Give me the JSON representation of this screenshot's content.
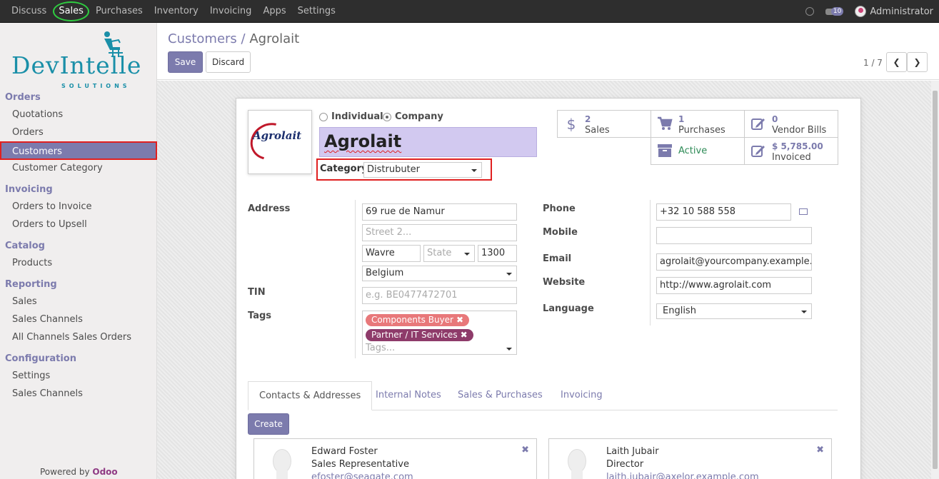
{
  "topbar": {
    "menu": [
      "Discuss",
      "Sales",
      "Purchases",
      "Inventory",
      "Invoicing",
      "Apps",
      "Settings"
    ],
    "active_menu": "Sales",
    "chat_count": "10",
    "user": "Administrator"
  },
  "sidebar": {
    "logo_word": "DevIntelle",
    "logo_sub": "SOLUTIONS",
    "sections": [
      {
        "title": "Orders",
        "items": [
          "Quotations",
          "Orders",
          "Customers",
          "Customer Category"
        ]
      },
      {
        "title": "Invoicing",
        "items": [
          "Orders to Invoice",
          "Orders to Upsell"
        ]
      },
      {
        "title": "Catalog",
        "items": [
          "Products"
        ]
      },
      {
        "title": "Reporting",
        "items": [
          "Sales",
          "Sales Channels",
          "All Channels Sales Orders"
        ]
      },
      {
        "title": "Configuration",
        "items": [
          "Settings",
          "Sales Channels"
        ]
      }
    ],
    "active_item": "Customers",
    "powered_by": "Powered by",
    "powered_brand": "Odoo"
  },
  "control_panel": {
    "breadcrumb_parent": "Customers",
    "breadcrumb_sep": "/",
    "breadcrumb_current": "Agrolait",
    "save_label": "Save",
    "discard_label": "Discard",
    "pager": "1 / 7",
    "prev_icon": "chevron-left-icon",
    "next_icon": "chevron-right-icon"
  },
  "partner": {
    "logo_text": "Agrolait",
    "type_individual": "Individual",
    "type_company": "Company",
    "selected_type": "Company",
    "name": "Agrolait",
    "category_label": "Category",
    "category_value": "Distrubuter"
  },
  "smart_buttons": {
    "sales_count": "2",
    "sales_label": "Sales",
    "purchases_count": "1",
    "purchases_label": "Purchases",
    "vendor_bills_count": "0",
    "vendor_bills_label": "Vendor Bills",
    "active_label": "Active",
    "invoiced_value": "$ 5,785.00",
    "invoiced_label": "Invoiced"
  },
  "form": {
    "address_label": "Address",
    "street": "69 rue de Namur",
    "street2_placeholder": "Street 2...",
    "city": "Wavre",
    "state_placeholder": "State",
    "zip": "1300",
    "country": "Belgium",
    "tin_label": "TIN",
    "tin_placeholder": "e.g. BE0477472701",
    "tags_label": "Tags",
    "tags": [
      {
        "label": "Components Buyer",
        "color": "#e8787a"
      },
      {
        "label": "Partner / IT Services",
        "color": "#8e3b6a"
      }
    ],
    "tags_placeholder": "Tags...",
    "phone_label": "Phone",
    "phone": "+32 10 588 558",
    "mobile_label": "Mobile",
    "mobile": "",
    "email_label": "Email",
    "email": "agrolait@yourcompany.example.com",
    "website_label": "Website",
    "website": "http://www.agrolait.com",
    "language_label": "Language",
    "language": "English"
  },
  "tabs": [
    "Contacts & Addresses",
    "Internal Notes",
    "Sales & Purchases",
    "Invoicing"
  ],
  "active_tab": "Contacts & Addresses",
  "create_label": "Create",
  "contacts": [
    {
      "name": "Edward Foster",
      "title": "Sales Representative",
      "email": "efoster@seagate.com"
    },
    {
      "name": "Laith Jubair",
      "title": "Director",
      "email": "laith.jubair@axelor.example.com"
    }
  ],
  "colors": {
    "accent": "#7c7bad",
    "highlight_red": "#e02020",
    "topbar": "#2e2e2e",
    "name_bg": "#d2c9f0"
  }
}
